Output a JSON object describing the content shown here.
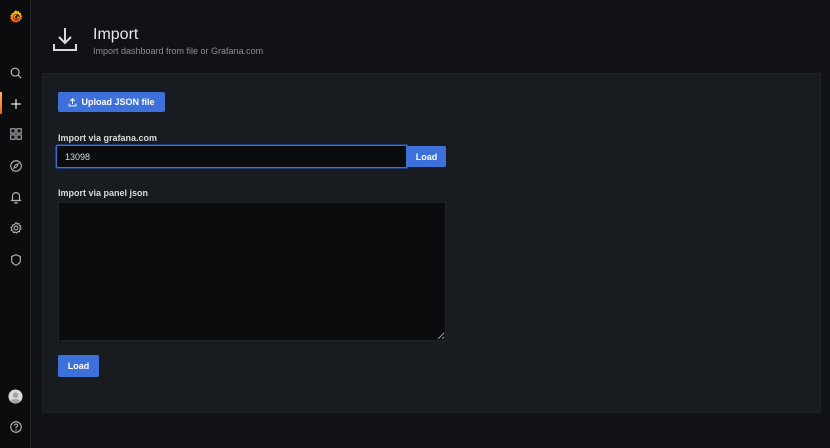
{
  "sidebar": {
    "items": [
      {
        "name": "grafana-logo",
        "icon": "grafana-logo-icon"
      },
      {
        "name": "search",
        "icon": "search-icon"
      },
      {
        "name": "create",
        "icon": "plus-icon"
      },
      {
        "name": "dashboards",
        "icon": "grid-icon"
      },
      {
        "name": "explore",
        "icon": "compass-icon"
      },
      {
        "name": "alerting",
        "icon": "bell-icon"
      },
      {
        "name": "configuration",
        "icon": "gear-icon"
      },
      {
        "name": "server-admin",
        "icon": "shield-icon"
      },
      {
        "name": "profile",
        "icon": "avatar-icon"
      },
      {
        "name": "help",
        "icon": "help-icon"
      }
    ],
    "accent": "#f58a33"
  },
  "header": {
    "title": "Import",
    "subtitle": "Import dashboard from file or Grafana.com",
    "icon": "import-download-icon"
  },
  "upload": {
    "label": "Upload JSON file",
    "icon": "upload-icon"
  },
  "grafana_com": {
    "label": "Import via grafana.com",
    "value": "13098",
    "load_label": "Load"
  },
  "panel_json": {
    "label": "Import via panel json",
    "value": "",
    "load_label": "Load"
  },
  "colors": {
    "primary": "#3d71d9",
    "background": "#111217",
    "panel": "#181b1f",
    "sidebar": "#0b0c0e"
  }
}
